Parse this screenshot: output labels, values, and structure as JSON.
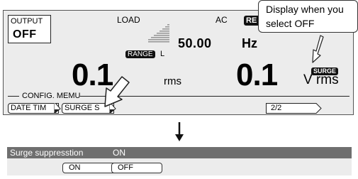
{
  "display": {
    "output": {
      "label": "OUTPUT",
      "value": "OFF"
    },
    "load_label": "LOAD",
    "mode": "AC",
    "re_tag": "RE",
    "frequency": {
      "value": "50.00",
      "unit": "Hz"
    },
    "range": {
      "tag": "RANGE",
      "value": "L"
    },
    "current": {
      "value": "0.1",
      "unit": "rms"
    },
    "voltage": {
      "value": "0.1",
      "unit": "V rms",
      "tag": "SURGE"
    },
    "config_label": "CONFIG. MEMU",
    "softkeys": [
      {
        "label": "DATE TIM"
      },
      {
        "label": "SURGE S"
      }
    ],
    "page": "2/2"
  },
  "callout": {
    "line1": "Display when you",
    "line2": "select OFF"
  },
  "surge": {
    "name": "Surge suppresstion",
    "state": "ON",
    "options": [
      "ON",
      "OFF"
    ]
  }
}
